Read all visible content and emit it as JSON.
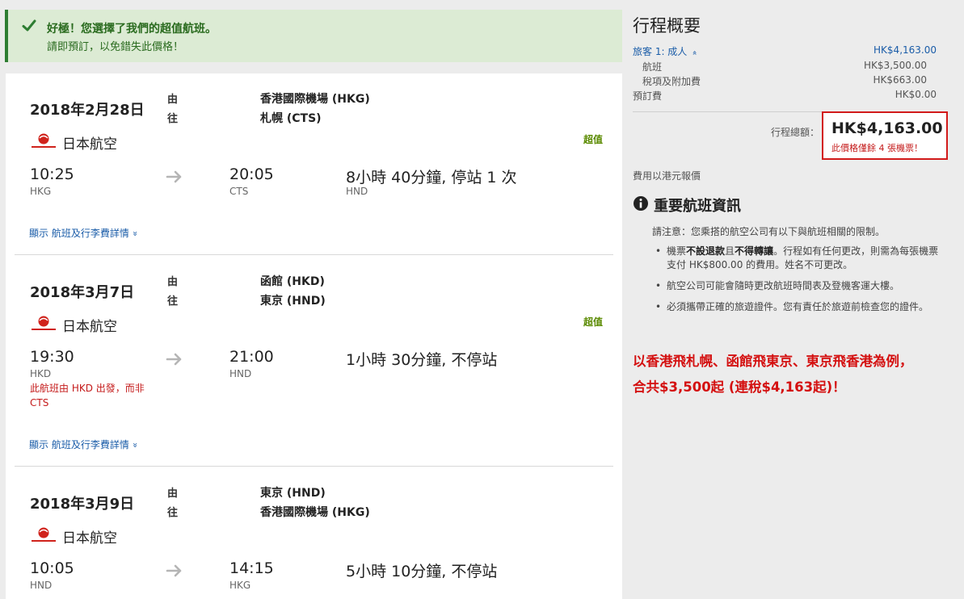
{
  "banner": {
    "line1": "好極！您選擇了我們的超值航班。",
    "line2": "請即預訂，以免錯失此價格！"
  },
  "labels": {
    "from": "由",
    "to": "往",
    "details": "顯示 航班及行李費詳情",
    "chevron": "»"
  },
  "flights": [
    {
      "date": "2018年2月28日",
      "from_airport": "香港國際機場 (HKG)",
      "to_airport": "札幌 (CTS)",
      "airline": "日本航空",
      "badge": "超值",
      "dep_time": "10:25",
      "dep_code": "HKG",
      "arr_time": "20:05",
      "arr_code": "CTS",
      "duration": "8小時 40分鐘, 停站 1 次",
      "via": "HND",
      "warning": ""
    },
    {
      "date": "2018年3月7日",
      "from_airport": "函館 (HKD)",
      "to_airport": "東京 (HND)",
      "airline": "日本航空",
      "badge": "超值",
      "dep_time": "19:30",
      "dep_code": "HKD",
      "arr_time": "21:00",
      "arr_code": "HND",
      "duration": "1小時 30分鐘, 不停站",
      "via": "",
      "warning": "此航班由 HKD 出發，而非 CTS"
    },
    {
      "date": "2018年3月9日",
      "from_airport": "東京 (HND)",
      "to_airport": "香港國際機場 (HKG)",
      "airline": "日本航空",
      "badge": "",
      "dep_time": "10:05",
      "dep_code": "HND",
      "arr_time": "14:15",
      "arr_code": "HKG",
      "duration": "5小時 10分鐘, 不停站",
      "via": "",
      "warning": ""
    }
  ],
  "summary": {
    "title": "行程概要",
    "traveler_label": "旅客 1: 成人",
    "traveler_value": "HK$4,163.00",
    "flight_label": "航班",
    "flight_value": "HK$3,500.00",
    "tax_label": "稅項及附加費",
    "tax_value": "HK$663.00",
    "booking_label": "預訂費",
    "booking_value": "HK$0.00",
    "total_label": "行程總額：",
    "total_value": "HK$4,163.00",
    "seats_note": "此價格僅餘 4 張機票！",
    "currency_note": "費用以港元報價"
  },
  "info": {
    "title": "重要航班資訊",
    "notice": "請注意：您乘搭的航空公司有以下與航班相關的限制。",
    "item1_a": "機票",
    "item1_b": "不設退款",
    "item1_c": "且",
    "item1_d": "不得轉讓",
    "item1_e": "。行程如有任何更改，則需為每張機票支付 HK$800.00 的費用。姓名不可更改。",
    "item2": "航空公司可能會隨時更改航班時間表及登機客運大樓。",
    "item3": "必須攜帶正確的旅遊證件。您有責任於旅遊前檢查您的證件。"
  },
  "promo": {
    "line1": "以香港飛札幌、函館飛東京、東京飛香港為例，",
    "line2": "合共$3,500起 (連稅$4,163起)！"
  },
  "colors": {
    "brand_red": "#d41010",
    "link_blue": "#1a5ca8",
    "success_green": "#2e7d32"
  },
  "icons": {
    "banner": "checkmark-icon",
    "arrow": "arrow-right-icon",
    "info": "info-circle-icon",
    "airline": "jal-crane-logo"
  }
}
